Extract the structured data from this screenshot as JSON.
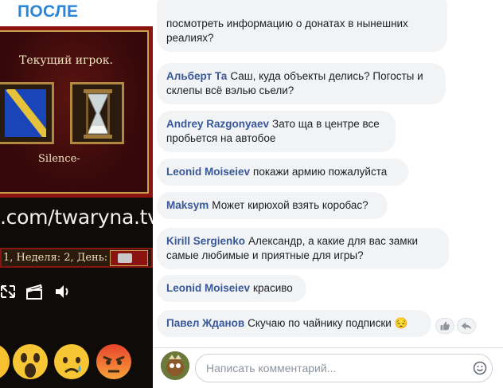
{
  "banner": {
    "label": "ПОСЛЕ"
  },
  "stream": {
    "current_player_label": "Текущий игрок.",
    "player_name": "Silence-",
    "url_overlay": ".com/twaryna.tv",
    "status_text": "1, Неделя: 2, День: 2"
  },
  "reactions": [
    "wow-emoji",
    "sad-emoji",
    "angry-emoji"
  ],
  "comments": [
    {
      "author": "",
      "text": "посмотреть информацию о донатах в нынешних реалиях?"
    },
    {
      "author": "Альберт Та",
      "text": "Саш, куда объекты делись? Погосты и склепы всё вэлью сьели?"
    },
    {
      "author": "Andrey Razgonyaev",
      "text": "Зато ща в центре все пробьется на автобое"
    },
    {
      "author": "Leonid Moiseiev",
      "text": "покажи армию пожалуйста"
    },
    {
      "author": "Maksym",
      "text": "Может кирюхой взять коробас?"
    },
    {
      "author": "Kirill Sergienko",
      "text": "Александр, а какие для вас замки самые любимые и приятные для игры?"
    },
    {
      "author": "Leonid Moiseiev",
      "text": "красиво"
    },
    {
      "author": "Павел Жданов",
      "text": "Скучаю по чайнику подписки 😔"
    }
  ],
  "composer": {
    "placeholder": "Написать комментарий..."
  },
  "colors": {
    "banner": "#2a86d8",
    "author": "#385898",
    "bubble": "#f2f3f5"
  }
}
